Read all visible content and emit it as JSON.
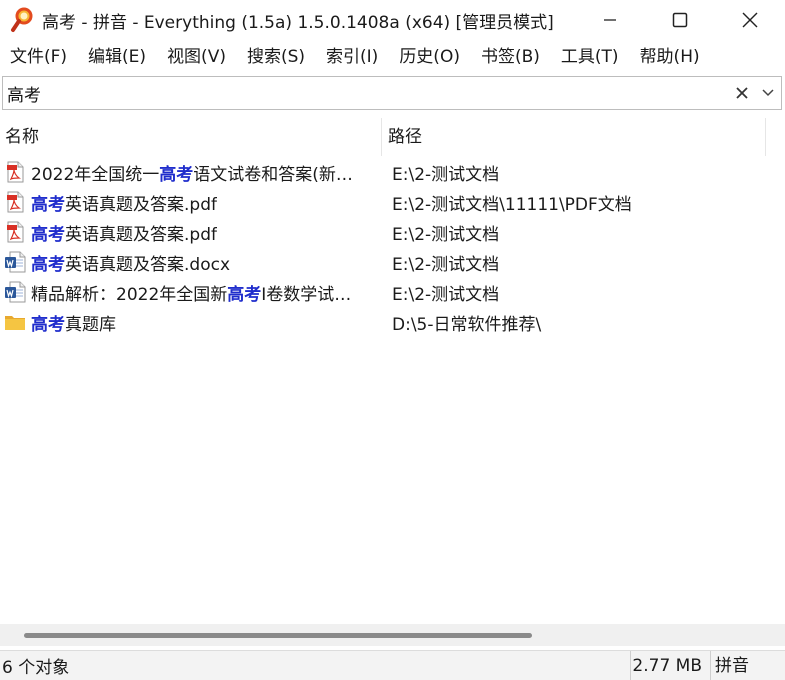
{
  "window": {
    "title": "高考 - 拼音 - Everything (1.5a) 1.5.0.1408a (x64) [管理员模式]",
    "app_icon": "magnifier-icon"
  },
  "menu": [
    "文件(F)",
    "编辑(E)",
    "视图(V)",
    "搜索(S)",
    "索引(I)",
    "历史(O)",
    "书签(B)",
    "工具(T)",
    "帮助(H)"
  ],
  "search": {
    "value": "高考"
  },
  "columns": {
    "name": "名称",
    "path": "路径"
  },
  "results": [
    {
      "icon": "pdf-icon",
      "pre": "2022年全国统一",
      "hl": "高考",
      "post": "语文试卷和答案(新…",
      "path": "E:\\2-测试文档"
    },
    {
      "icon": "pdf-icon",
      "pre": "",
      "hl": "高考",
      "post": "英语真题及答案.pdf",
      "path": "E:\\2-测试文档\\11111\\PDF文档"
    },
    {
      "icon": "pdf-icon",
      "pre": "",
      "hl": "高考",
      "post": "英语真题及答案.pdf",
      "path": "E:\\2-测试文档"
    },
    {
      "icon": "word-icon",
      "pre": "",
      "hl": "高考",
      "post": "英语真题及答案.docx",
      "path": "E:\\2-测试文档"
    },
    {
      "icon": "word-icon",
      "pre": "精品解析：2022年全国新",
      "hl": "高考",
      "post": "I卷数学试…",
      "path": "E:\\2-测试文档"
    },
    {
      "icon": "folder-icon",
      "pre": "",
      "hl": "高考",
      "post": "真题库",
      "path": "D:\\5-日常软件推荐\\"
    }
  ],
  "status": {
    "count": "6 个对象",
    "size": "2.77 MB",
    "mode": "拼音"
  },
  "colors": {
    "highlight": "#1f2dcc",
    "folder": "#f5c542",
    "pdf": "#d93025",
    "word": "#2b579a"
  }
}
